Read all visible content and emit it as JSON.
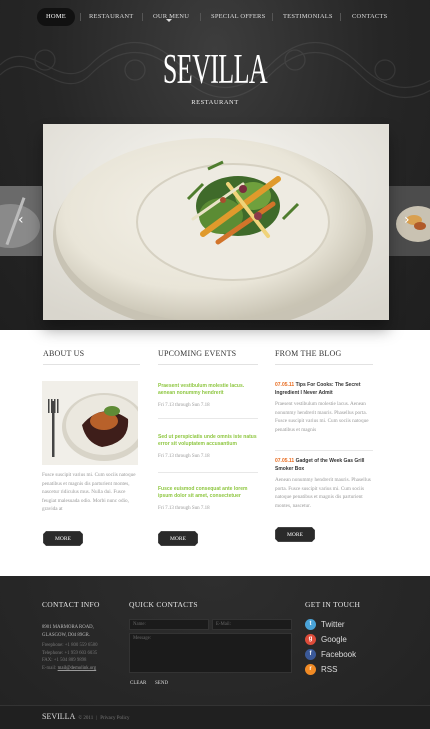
{
  "nav": {
    "items": [
      {
        "label": "HOME",
        "active": true
      },
      {
        "label": "RESTAURANT"
      },
      {
        "label": "OUR MENU",
        "has_dropdown": true
      },
      {
        "label": "SPECIAL OFFERS"
      },
      {
        "label": "TESTIMONIALS"
      },
      {
        "label": "CONTACTS"
      }
    ]
  },
  "brand": {
    "name": "SEVILLA",
    "tagline": "RESTAURANT"
  },
  "slider": {
    "prev_icon": "chevron-left-icon",
    "next_icon": "chevron-right-icon"
  },
  "about": {
    "heading": "ABOUT US",
    "text": "Fusce suscipit varius mi. Cum sociis natoque penatibus et magnis dis parturient montes, nascetur ridiculus mus. Nulla dui. Fusce feugiat malesuada odio. Morbi nunc odio, gravida at",
    "more_label": "MORE"
  },
  "events": {
    "heading": "UPCOMING EVENTS",
    "items": [
      {
        "title": "Praesent vestibulum molestie lacus. aenean nonummy hendrerit",
        "date": "Fri 7.13 through Sun 7.18"
      },
      {
        "title": "Sed ut perspiciatis unde omnis iste natus error sit voluptatem accusantium",
        "date": "Fri 7.13 through Sun 7.18"
      },
      {
        "title": "Fusce euismod consequat ante lorem ipsum dolor sit amet, consectetuer",
        "date": "Fri 7.13 through Sun 7.18"
      }
    ],
    "more_label": "MORE"
  },
  "blog": {
    "heading": "FROM THE BLOG",
    "items": [
      {
        "date": "07.05.11",
        "title": "Tips For Cooks: The Secret Ingredient I Never Admit",
        "text": "Praesent vestibulum molestie lacus. Aenean nonummy hendrerit mauris. Phasellus porta. Fusce suscipit varius mi. Cum sociis natoque penatibus et magnis"
      },
      {
        "date": "07.05.11",
        "title": "Gadget of the Week Gas Grill Smoker Box",
        "text": "Aenean nonummy hendrerit mauris. Phasellus porta. Fusce suscipit varius mi. Cum sociis natoque penatibus et magnis dis parturient montes, nascetur."
      }
    ],
    "more_label": "MORE"
  },
  "contact_info": {
    "heading": "CONTACT INFO",
    "address_line1": "8901 MARMORA ROAD,",
    "address_line2": "GLASGOW, D04 89GR.",
    "freephone": "Freephone: +1 800 559 6580",
    "telephone": "Telephone: +1 959 603 6035",
    "fax": "FAX: +1 504 889 9898",
    "email_label": "E-mail: ",
    "email": "mail@demolink.org"
  },
  "quick_contacts": {
    "heading": "QUICK CONTACTS",
    "name_placeholder": "Name:",
    "email_placeholder": "E-Mail:",
    "message_placeholder": "Message:",
    "clear_label": "CLEAR",
    "send_label": "SEND"
  },
  "get_in_touch": {
    "heading": "GET IN TOUCH",
    "items": [
      {
        "label": "Twitter",
        "icon": "twitter-icon",
        "color": "#4aa3d8"
      },
      {
        "label": "Google",
        "icon": "google-icon",
        "color": "#dd4b39"
      },
      {
        "label": "Facebook",
        "icon": "facebook-icon",
        "color": "#3b5998"
      },
      {
        "label": "RSS",
        "icon": "rss-icon",
        "color": "#f08a24"
      }
    ]
  },
  "footer": {
    "brand": "SEVILLA",
    "copyright": "© 2011",
    "privacy": "Privacy Policy"
  }
}
